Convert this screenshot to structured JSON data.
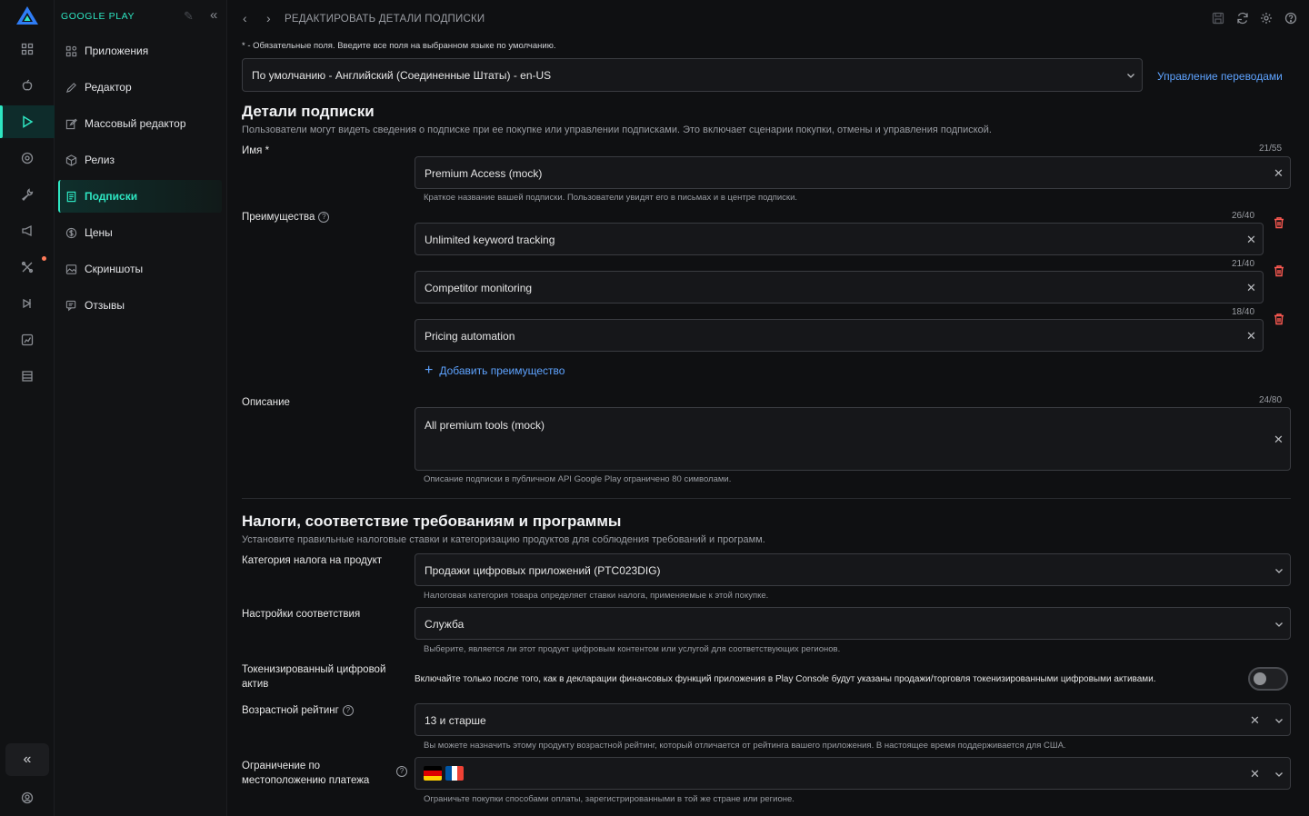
{
  "nav": {
    "title": "GOOGLE PLAY",
    "items": [
      {
        "label": "Приложения"
      },
      {
        "label": "Редактор"
      },
      {
        "label": "Массовый редактор"
      },
      {
        "label": "Релиз"
      },
      {
        "label": "Подписки"
      },
      {
        "label": "Цены"
      },
      {
        "label": "Скриншоты"
      },
      {
        "label": "Отзывы"
      }
    ]
  },
  "header": {
    "breadcrumb": "РЕДАКТИРОВАТЬ ДЕТАЛИ ПОДПИСКИ"
  },
  "form": {
    "required_note": "* - Обязательные поля. Введите все поля на выбранном языке по умолчанию.",
    "language": "По умолчанию - Английский (Соединенные Штаты) - en-US",
    "manage_translations": "Управление переводами",
    "details": {
      "title": "Детали подписки",
      "subtitle": "Пользователи могут видеть сведения о подписке при ее покупке или управлении подписками. Это включает сценарии покупки, отмены и управления подпиской.",
      "name_label": "Имя *",
      "name_value": "Premium Access (mock)",
      "name_counter": "21/55",
      "name_hint": "Краткое название вашей подписки. Пользователи увидят его в письмах и в центре подписки.",
      "benefits_label": "Преимущества",
      "benefits": [
        {
          "value": "Unlimited keyword tracking",
          "counter": "26/40"
        },
        {
          "value": "Competitor monitoring",
          "counter": "21/40"
        },
        {
          "value": "Pricing automation",
          "counter": "18/40"
        }
      ],
      "add_benefit": "Добавить преимущество",
      "description_label": "Описание",
      "description_value": "All premium tools (mock)",
      "description_counter": "24/80",
      "description_hint": "Описание подписки в публичном API Google Play ограничено 80 символами."
    },
    "tax": {
      "title": "Налоги, соответствие требованиям и программы",
      "subtitle": "Установите правильные налоговые ставки и категоризацию продуктов для соблюдения требований и программ.",
      "category_label": "Категория налога на продукт",
      "category_value": "Продажи цифровых приложений (PTC023DIG)",
      "category_hint": "Налоговая категория товара определяет ставки налога, применяемые к этой покупке.",
      "compliance_label": "Настройки соответствия",
      "compliance_value": "Служба",
      "compliance_hint": "Выберите, является ли этот продукт цифровым контентом или услугой для соответствующих регионов.",
      "token_label_1": "Токенизированный цифровой",
      "token_label_2": "актив",
      "token_text": "Включайте только после того, как в декларации финансовых функций приложения в Play Console будут указаны продажи/торговля токенизированными цифровыми активами.",
      "token_enabled": false,
      "age_label": "Возрастной рейтинг",
      "age_value": "13 и старше",
      "age_hint": "Вы можете назначить этому продукту возрастной рейтинг, который отличается от рейтинга вашего приложения. В настоящее время поддерживается для США.",
      "location_label_1": "Ограничение по",
      "location_label_2": "местоположению платежа",
      "location_flags": [
        "flag-germany",
        "flag-france"
      ],
      "location_hint": "Ограничьте покупки способами оплаты, зарегистрированными в той же стране или регионе."
    }
  },
  "colors": {
    "accent": "#2ee6c2",
    "link": "#5ea3ff",
    "danger": "#ff5a52",
    "background": "#0f1012"
  }
}
